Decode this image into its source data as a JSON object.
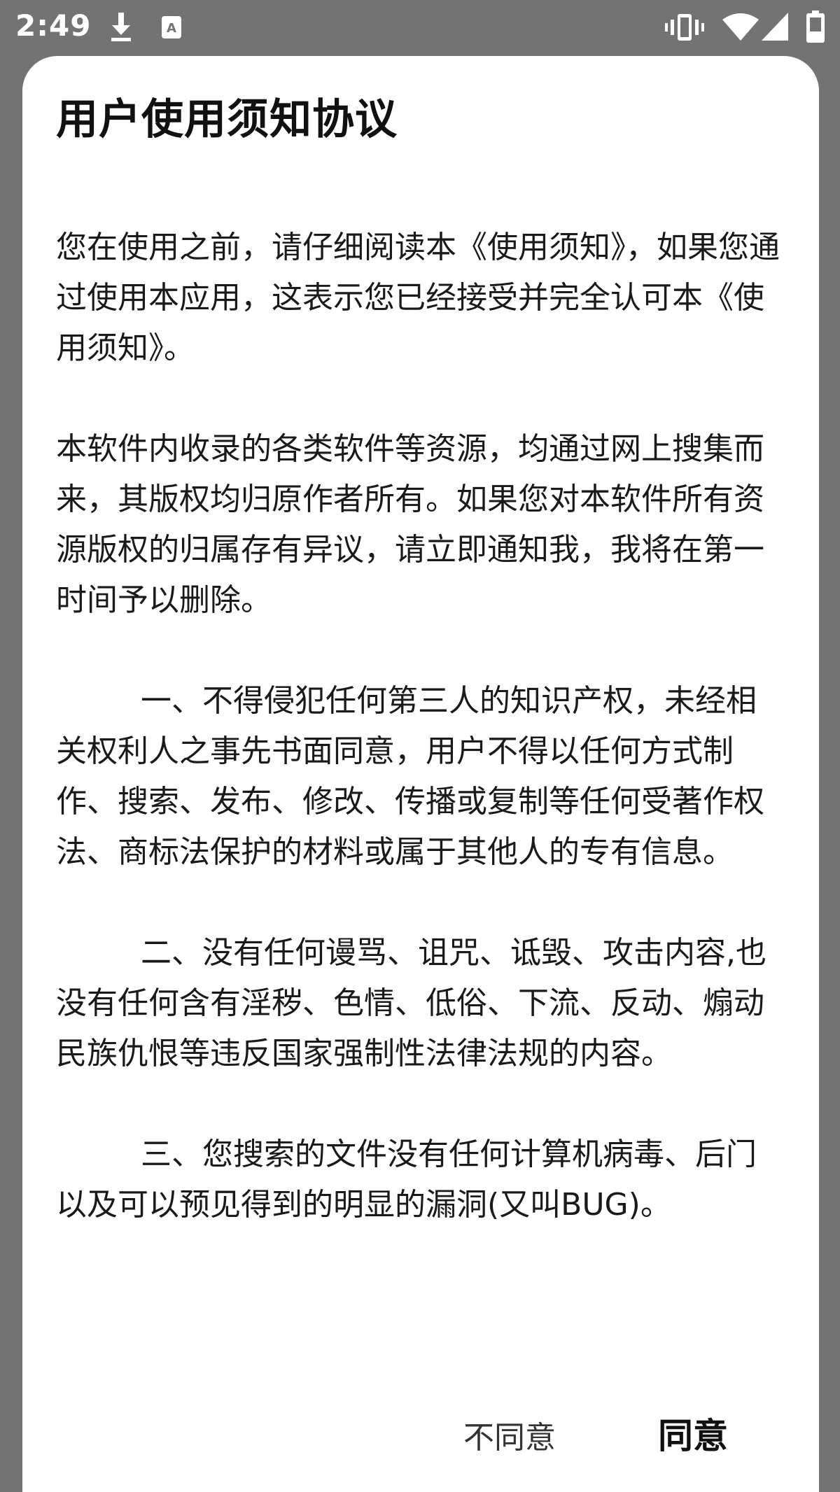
{
  "status_bar": {
    "time": "2:49",
    "icons": [
      "download-icon",
      "app-notification-icon",
      "vibrate-icon",
      "wifi-icon",
      "signal-icon",
      "battery-icon"
    ]
  },
  "dialog": {
    "title": "用户使用须知协议",
    "paragraphs": [
      "您在使用之前，请仔细阅读本《使用须知》，如果您通过使用本应用，这表示您已经接受并完全认可本《使用须知》。",
      "本软件内收录的各类软件等资源，均通过网上搜集而来，其版权均归原作者所有。如果您对本软件所有资源版权的归属存有异议，请立即通知我，我将在第一时间予以删除。",
      "一、不得侵犯任何第三人的知识产权，未经相关权利人之事先书面同意，用户不得以任何方式制作、搜索、发布、修改、传播或复制等任何受著作权法、商标法保护的材料或属于其他人的专有信息。",
      "二、没有任何谩骂、诅咒、诋毁、攻击内容,也没有任何含有淫秽、色情、低俗、下流、反动、煽动民族仇恨等违反国家强制性法律法规的内容。",
      "三、您搜索的文件没有任何计算机病毒、后门以及可以预见得到的明显的漏洞(又叫BUG)。"
    ],
    "buttons": {
      "disagree": "不同意",
      "agree": "同意"
    }
  },
  "colors": {
    "scrim": "#737373",
    "dialog_background": "#ffffff",
    "text": "#1a1a1a"
  }
}
